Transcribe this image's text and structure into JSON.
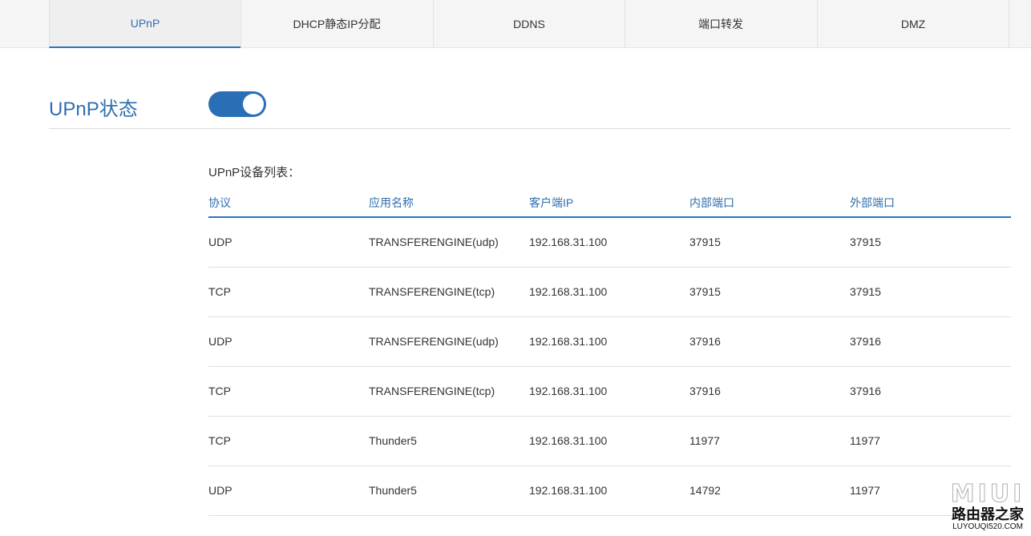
{
  "tabs": [
    {
      "label": "UPnP",
      "active": true
    },
    {
      "label": "DHCP静态IP分配",
      "active": false
    },
    {
      "label": "DDNS",
      "active": false
    },
    {
      "label": "端口转发",
      "active": false
    },
    {
      "label": "DMZ",
      "active": false
    }
  ],
  "upnp": {
    "title": "UPnP状态",
    "toggle_on": true,
    "list_title": "UPnP设备列表："
  },
  "table": {
    "headers": [
      "协议",
      "应用名称",
      "客户端IP",
      "内部端口",
      "外部端口"
    ],
    "rows": [
      [
        "UDP",
        "TRANSFERENGINE(udp)",
        "192.168.31.100",
        "37915",
        "37915"
      ],
      [
        "TCP",
        "TRANSFERENGINE(tcp)",
        "192.168.31.100",
        "37915",
        "37915"
      ],
      [
        "UDP",
        "TRANSFERENGINE(udp)",
        "192.168.31.100",
        "37916",
        "37916"
      ],
      [
        "TCP",
        "TRANSFERENGINE(tcp)",
        "192.168.31.100",
        "37916",
        "37916"
      ],
      [
        "TCP",
        "Thunder5",
        "192.168.31.100",
        "11977",
        "11977"
      ],
      [
        "UDP",
        "Thunder5",
        "192.168.31.100",
        "14792",
        "11977"
      ]
    ]
  },
  "watermark": {
    "logo": "MIUI",
    "site_name": "路由器之家",
    "url": "LUYOUQI520.COM"
  },
  "colors": {
    "accent": "#2b74bc",
    "title_blue": "#2f6fae",
    "toggle": "#2a6fb6"
  }
}
